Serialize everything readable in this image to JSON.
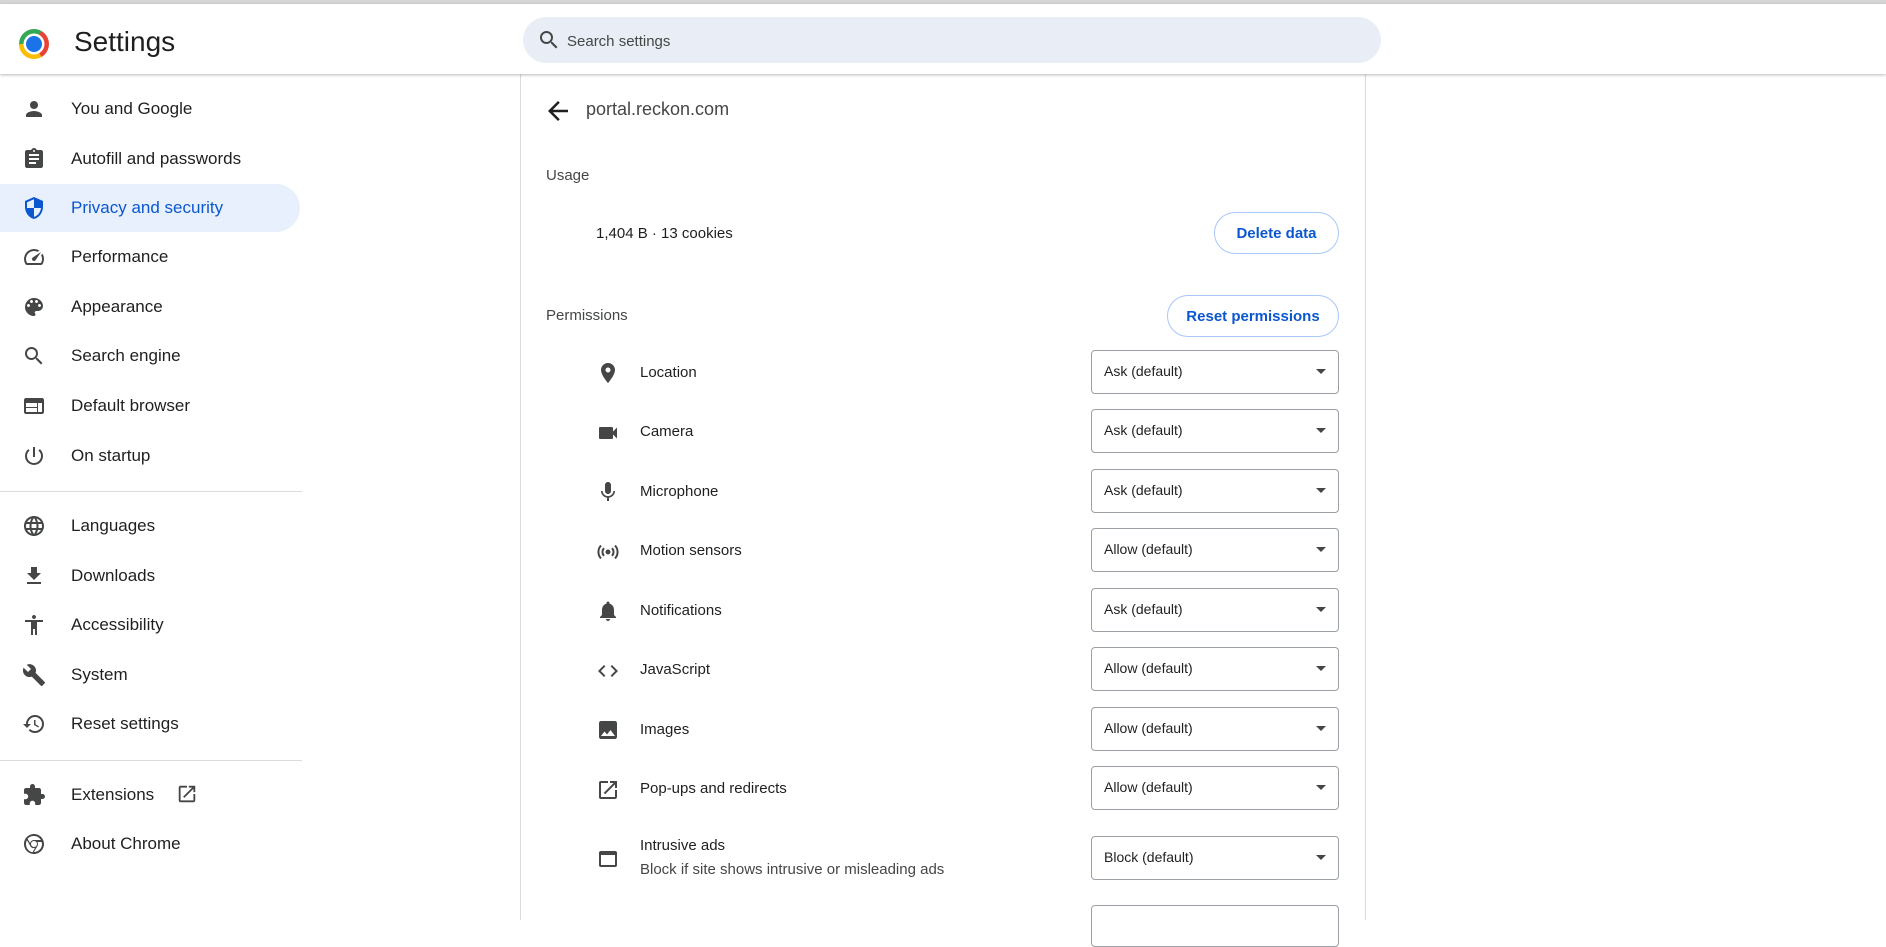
{
  "header": {
    "title": "Settings",
    "search_placeholder": "Search settings"
  },
  "sidebar": {
    "items": [
      {
        "label": "You and Google",
        "icon": "person-icon"
      },
      {
        "label": "Autofill and passwords",
        "icon": "clipboard-icon"
      },
      {
        "label": "Privacy and security",
        "icon": "shield-icon",
        "active": true
      },
      {
        "label": "Performance",
        "icon": "speedometer-icon"
      },
      {
        "label": "Appearance",
        "icon": "palette-icon"
      },
      {
        "label": "Search engine",
        "icon": "search-icon"
      },
      {
        "label": "Default browser",
        "icon": "browser-window-icon"
      },
      {
        "label": "On startup",
        "icon": "power-icon"
      },
      {
        "label": "Languages",
        "icon": "globe-icon"
      },
      {
        "label": "Downloads",
        "icon": "download-icon"
      },
      {
        "label": "Accessibility",
        "icon": "accessibility-icon"
      },
      {
        "label": "System",
        "icon": "wrench-icon"
      },
      {
        "label": "Reset settings",
        "icon": "history-icon"
      },
      {
        "label": "Extensions",
        "icon": "puzzle-icon"
      },
      {
        "label": "About Chrome",
        "icon": "chrome-icon"
      }
    ]
  },
  "site": {
    "title": "portal.reckon.com",
    "usage_label": "Usage",
    "usage_text": "1,404 B · 13 cookies",
    "delete_label": "Delete data",
    "permissions_label": "Permissions",
    "reset_label": "Reset permissions",
    "permissions": [
      {
        "label": "Location",
        "value": "Ask (default)",
        "icon": "location-pin-icon"
      },
      {
        "label": "Camera",
        "value": "Ask (default)",
        "icon": "camera-icon"
      },
      {
        "label": "Microphone",
        "value": "Ask (default)",
        "icon": "microphone-icon"
      },
      {
        "label": "Motion sensors",
        "value": "Allow (default)",
        "icon": "motion-sensor-icon"
      },
      {
        "label": "Notifications",
        "value": "Ask (default)",
        "icon": "bell-icon"
      },
      {
        "label": "JavaScript",
        "value": "Allow (default)",
        "icon": "code-icon"
      },
      {
        "label": "Images",
        "value": "Allow (default)",
        "icon": "image-icon"
      },
      {
        "label": "Pop-ups and redirects",
        "value": "Allow (default)",
        "icon": "open-external-icon"
      },
      {
        "label": "Intrusive ads",
        "sublabel": "Block if site shows intrusive or misleading ads",
        "value": "Block (default)",
        "icon": "ad-window-icon"
      }
    ]
  },
  "colors": {
    "accent": "#0b57d0",
    "active_bg": "#e8f0fe",
    "search_bg": "#e9eef6",
    "icon": "#444746"
  }
}
